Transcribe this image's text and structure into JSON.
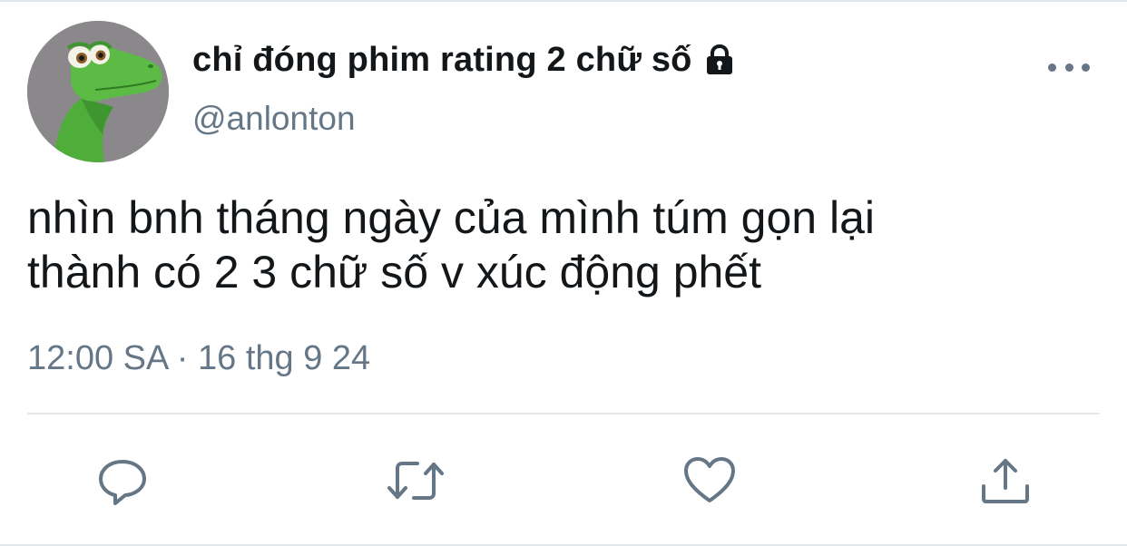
{
  "tweet": {
    "display_name": "chỉ đóng phim rating 2 chữ số",
    "handle": "@anlonton",
    "text_lines": [
      "nhìn bnh tháng ngày của mình túm gọn lại",
      "thành có 2 3 chữ số v xúc động phết"
    ],
    "timestamp": "12:00 SA · 16 thg 9 24",
    "protected_icon": "lock-icon",
    "avatar": "green-dinosaur-avatar"
  },
  "actions": [
    {
      "icon": "reply-icon"
    },
    {
      "icon": "retweet-icon"
    },
    {
      "icon": "like-icon"
    },
    {
      "icon": "share-icon"
    }
  ],
  "colors": {
    "text_primary": "#14171a",
    "text_secondary": "#657786",
    "icon": "#657786",
    "divider": "#e1e8ed",
    "background": "#ffffff"
  }
}
